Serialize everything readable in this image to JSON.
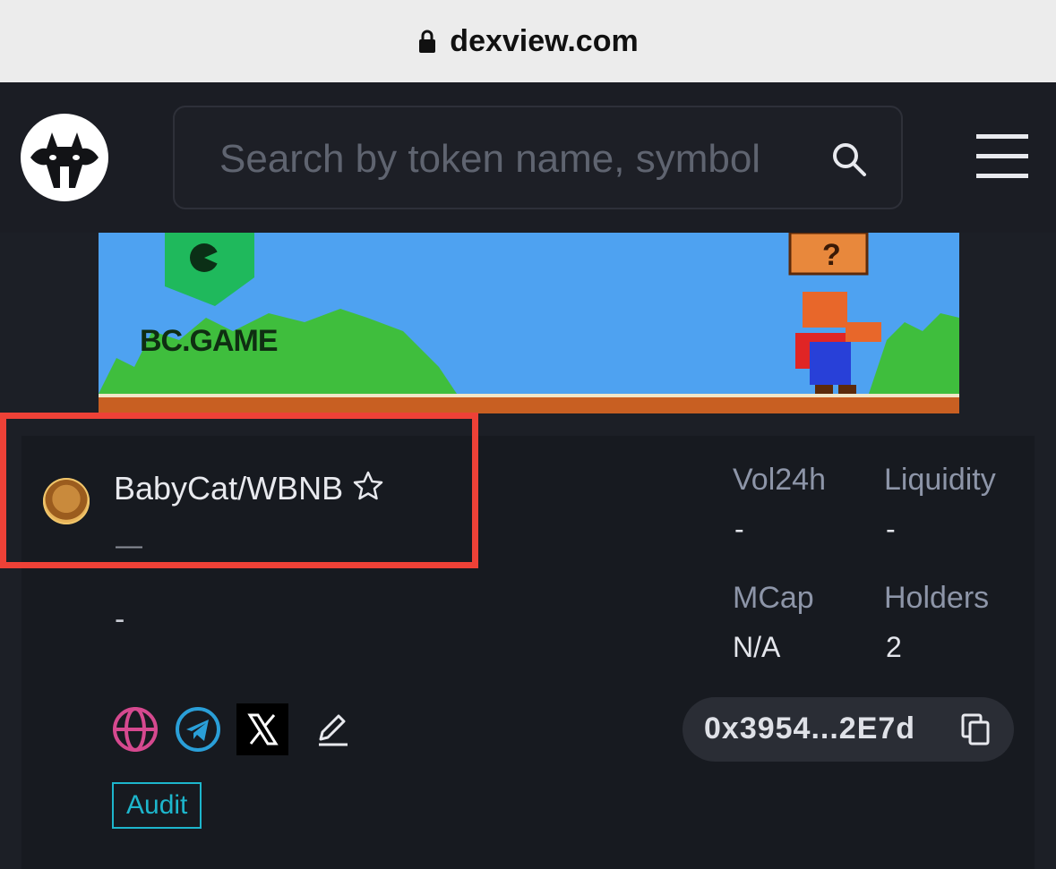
{
  "browser": {
    "url": "dexview.com",
    "lock_icon": "lock-icon"
  },
  "header": {
    "logo_icon": "cat-logo-icon",
    "search_placeholder": "Search by token name, symbol",
    "search_icon": "search-icon",
    "menu_icon": "hamburger-menu-icon"
  },
  "banner": {
    "label": "BC.GAME",
    "sky_color": "#4ea2f1"
  },
  "token": {
    "pair": "BabyCat/WBNB",
    "favorite_icon": "star-outline-icon",
    "sub": "—",
    "description": "-",
    "stats": {
      "vol24h_label": "Vol24h",
      "vol24h_value": "-",
      "liquidity_label": "Liquidity",
      "liquidity_value": "-",
      "mcap_label": "MCap",
      "mcap_value": "N/A",
      "holders_label": "Holders",
      "holders_value": "2"
    },
    "social": [
      "website-icon",
      "telegram-icon",
      "x-icon",
      "edit-icon"
    ],
    "audit_label": "Audit",
    "address": "0x3954...2E7d",
    "copy_icon": "copy-icon"
  },
  "colors": {
    "highlight": "#ee4137",
    "accent_cyan": "#1db6cc",
    "website_pink": "#d6498f",
    "telegram_blue": "#2a9fd8"
  }
}
